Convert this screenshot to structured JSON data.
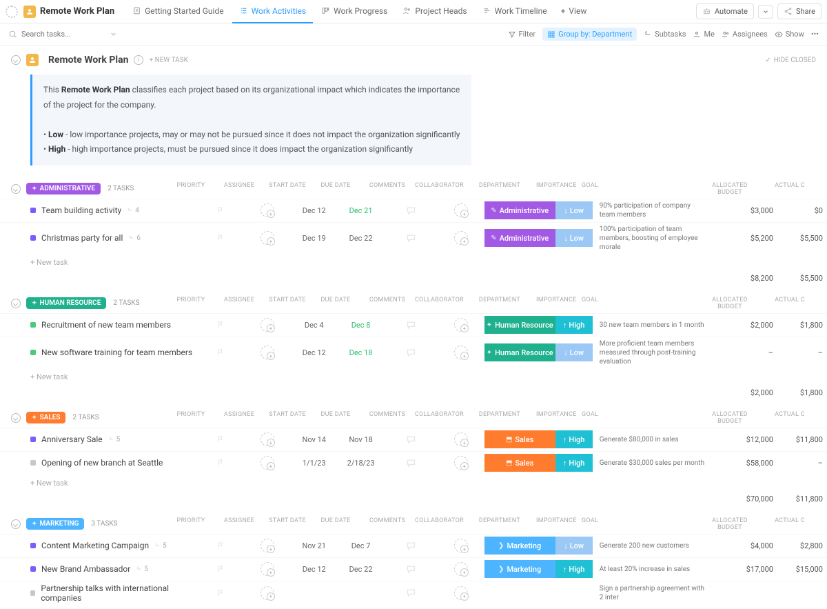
{
  "space_title": "Remote Work Plan",
  "views": [
    "Getting Started Guide",
    "Work Activities",
    "Work Progress",
    "Project Heads",
    "Work Timeline"
  ],
  "view_add": "View",
  "automate": "Automate",
  "share": "Share",
  "search_ph": "Search tasks...",
  "toolbar": {
    "filter": "Filter",
    "groupby": "Group by: Department",
    "subtasks": "Subtasks",
    "me": "Me",
    "assignees": "Assignees",
    "show": "Show"
  },
  "page_title": "Remote Work Plan",
  "new_task": "+ NEW TASK",
  "hide_closed": "HIDE CLOSED",
  "desc": {
    "p1a": "This ",
    "p1b": "Remote Work Plan",
    "p1c": " classifies each project based on its organizational impact which indicates the importance of the project for the company.",
    "p2a": "• ",
    "p2b": "Low",
    "p2c": " - low importance projects, may or may not be pursued since it does not impact the organization significantly",
    "p3a": "• ",
    "p3b": "High",
    "p3c": " - high importance projects, must be pursued since it does impact the organization significantly"
  },
  "cols": [
    "PRIORITY",
    "ASSIGNEE",
    "START DATE",
    "DUE DATE",
    "COMMENTS",
    "COLLABORATOR",
    "DEPARTMENT",
    "IMPORTANCE",
    "GOAL",
    "ALLOCATED BUDGET",
    "ACTUAL C"
  ],
  "newtask_row": "+ New task",
  "groups": [
    {
      "name": "Administrative",
      "color": "bg-admin",
      "count": "2 TASKS",
      "tasks": [
        {
          "sq": "sq-purple",
          "name": "Team building activity",
          "sub": "4",
          "start": "Dec 12",
          "due": "Dec 21",
          "due_g": true,
          "dept": "Administrative",
          "dcolor": "bg-admin",
          "dicon": "✎",
          "imp": "Low",
          "icolor": "bg-low",
          "arrow": "↓",
          "goal": "90% participation of company team members",
          "budget": "$3,000",
          "actual": "$0"
        },
        {
          "sq": "sq-purple",
          "name": "Christmas party for all",
          "sub": "6",
          "start": "Dec 19",
          "due": "Dec 22",
          "due_g": false,
          "dept": "Administrative",
          "dcolor": "bg-admin",
          "dicon": "✎",
          "imp": "Low",
          "icolor": "bg-low",
          "arrow": "↓",
          "goal": "100% participation of team members, boosting of employee morale",
          "budget": "$5,200",
          "actual": "$5,500"
        }
      ],
      "t_budget": "$8,200",
      "t_actual": "$5,500"
    },
    {
      "name": "Human Resource",
      "color": "bg-hr",
      "count": "2 TASKS",
      "tasks": [
        {
          "sq": "sq-green",
          "name": "Recruitment of new team members",
          "sub": "",
          "start": "Dec 4",
          "due": "Dec 8",
          "due_g": true,
          "dept": "Human Resource",
          "dcolor": "bg-hr",
          "dicon": "✦",
          "imp": "High",
          "icolor": "bg-high",
          "arrow": "↑",
          "goal": "30 new team members in 1 month",
          "budget": "$2,000",
          "actual": "$1,800"
        },
        {
          "sq": "sq-green",
          "name": "New software training for team members",
          "sub": "",
          "start": "Dec 12",
          "due": "Dec 18",
          "due_g": true,
          "dept": "Human Resource",
          "dcolor": "bg-hr",
          "dicon": "✦",
          "imp": "Low",
          "icolor": "bg-low",
          "arrow": "↓",
          "goal": "More proficient team members measured through post-training evaluation",
          "budget": "–",
          "actual": "–"
        }
      ],
      "t_budget": "$2,000",
      "t_actual": "$1,800"
    },
    {
      "name": "Sales",
      "color": "bg-sales",
      "count": "2 TASKS",
      "tasks": [
        {
          "sq": "sq-purple",
          "name": "Anniversary Sale",
          "sub": "5",
          "start": "Nov 14",
          "due": "Nov 18",
          "due_g": false,
          "dept": "Sales",
          "dcolor": "bg-sales",
          "dicon": "⬒",
          "imp": "High",
          "icolor": "bg-high",
          "arrow": "↑",
          "goal": "Generate $80,000 in sales",
          "budget": "$12,000",
          "actual": "$11,800"
        },
        {
          "sq": "sq-grey",
          "name": "Opening of new branch at Seattle",
          "sub": "",
          "start": "1/1/23",
          "due": "2/18/23",
          "due_g": false,
          "dept": "Sales",
          "dcolor": "bg-sales",
          "dicon": "⬒",
          "imp": "High",
          "icolor": "bg-high",
          "arrow": "↑",
          "goal": "Generate $30,000 sales per month",
          "budget": "$58,000",
          "actual": "–"
        }
      ],
      "t_budget": "$70,000",
      "t_actual": "$11,800"
    },
    {
      "name": "Marketing",
      "color": "bg-mkt",
      "count": "3 TASKS",
      "tasks": [
        {
          "sq": "sq-purple",
          "name": "Content Marketing Campaign",
          "sub": "5",
          "start": "Nov 21",
          "due": "Dec 7",
          "due_g": false,
          "dept": "Marketing",
          "dcolor": "bg-mkt",
          "dicon": "❯",
          "imp": "Low",
          "icolor": "bg-low",
          "arrow": "↓",
          "goal": "Generate 200 new customers",
          "budget": "$4,000",
          "actual": "$2,800"
        },
        {
          "sq": "sq-purple",
          "name": "New Brand Ambassador",
          "sub": "5",
          "start": "Dec 12",
          "due": "Dec 22",
          "due_g": false,
          "dept": "Marketing",
          "dcolor": "bg-mkt",
          "dicon": "❯",
          "imp": "High",
          "icolor": "bg-high",
          "arrow": "↑",
          "goal": "At least 20% increase in sales",
          "budget": "$17,000",
          "actual": "$15,000"
        },
        {
          "sq": "sq-grey",
          "name": "Partnership talks with international companies",
          "sub": "",
          "start": "",
          "due": "",
          "due_g": false,
          "dept": "",
          "dcolor": "",
          "dicon": "",
          "imp": "",
          "icolor": "",
          "arrow": "",
          "goal": "Sign a partnership agreement with 2 inter",
          "budget": "",
          "actual": ""
        }
      ],
      "t_budget": "",
      "t_actual": ""
    }
  ]
}
